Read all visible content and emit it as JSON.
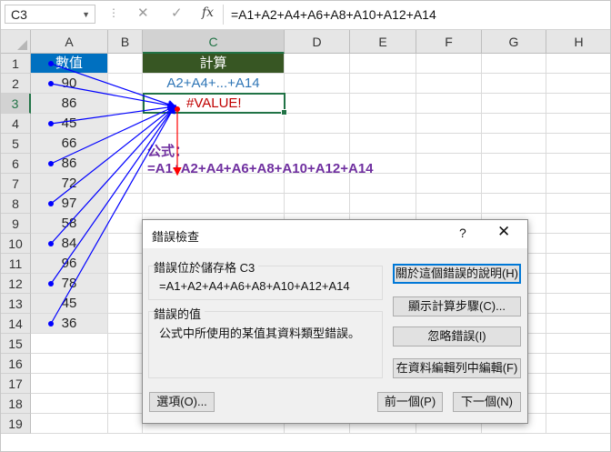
{
  "formula_bar": {
    "name_box": "C3",
    "fx": "fx",
    "formula": "=A1+A2+A4+A6+A8+A10+A12+A14"
  },
  "columns": [
    "A",
    "B",
    "C",
    "D",
    "E",
    "F",
    "G",
    "H"
  ],
  "rows": [
    "1",
    "2",
    "3",
    "4",
    "5",
    "6",
    "7",
    "8",
    "9",
    "10",
    "11",
    "12",
    "13",
    "14",
    "15",
    "16",
    "17",
    "18",
    "19"
  ],
  "col_a": [
    "數值",
    "90",
    "86",
    "45",
    "66",
    "86",
    "72",
    "97",
    "58",
    "84",
    "96",
    "78",
    "45",
    "36"
  ],
  "col_c": {
    "header": "計算",
    "label": "A2+A4+...+A14",
    "result": "#VALUE!"
  },
  "annotation": {
    "label": "公式：",
    "formula": "=A1+A2+A4+A6+A8+A10+A12+A14"
  },
  "dialog": {
    "title": "錯誤檢查",
    "help": "?",
    "close": "✕",
    "location": "錯誤位於儲存格 C3",
    "formula": "=A1+A2+A4+A6+A8+A10+A12+A14",
    "value_group": "錯誤的值",
    "description": "公式中所使用的某值其資料類型錯誤。",
    "buttons": {
      "help_error": "關於這個錯誤的說明(H)",
      "show_steps": "顯示計算步驟(C)...",
      "ignore": "忽略錯誤(I)",
      "edit_in_bar": "在資料編輯列中編輯(F)",
      "options": "選項(O)...",
      "previous": "前一個(P)",
      "next": "下一個(N)"
    }
  },
  "colors": {
    "header_a": "#0070c0",
    "header_c": "#375623",
    "label_blue": "#2e75b6",
    "error_red": "#c00000",
    "annot_purple": "#7030a0",
    "arrow_blue": "#0000ff",
    "arrow_red": "#ff0000",
    "select_green": "#217346"
  }
}
